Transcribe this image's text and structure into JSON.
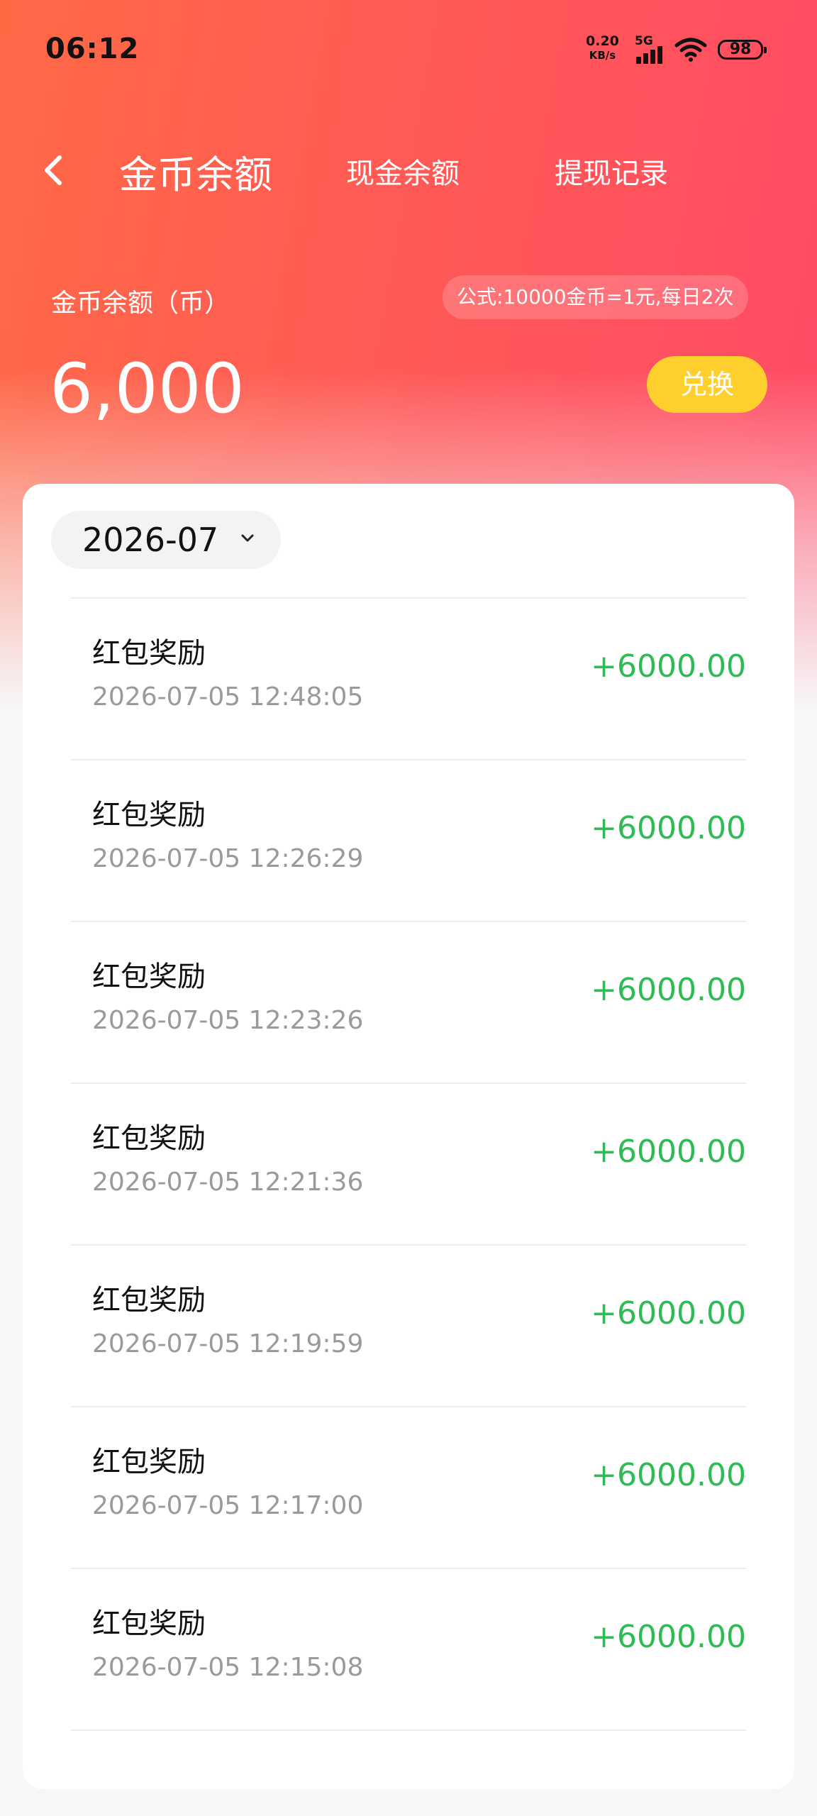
{
  "status_bar": {
    "time": "06:12",
    "net_speed": "0.20",
    "net_unit": "KB/s",
    "network": "5G",
    "battery": "98"
  },
  "nav": {
    "back_icon": "chevron-left-icon",
    "tabs": [
      {
        "label": "金币余额",
        "active": true
      },
      {
        "label": "现金余额",
        "active": false
      },
      {
        "label": "提现记录",
        "active": false
      }
    ]
  },
  "balance": {
    "label": "金币余额（币）",
    "formula": "公式:10000金币=1元,每日2次",
    "value": "6,000",
    "exchange_label": "兑换"
  },
  "filter": {
    "month": "2026-07"
  },
  "records": [
    {
      "title": "红包奖励",
      "time": "2026-07-05 12:48:05",
      "amount": "+6000.00"
    },
    {
      "title": "红包奖励",
      "time": "2026-07-05 12:26:29",
      "amount": "+6000.00"
    },
    {
      "title": "红包奖励",
      "time": "2026-07-05 12:23:26",
      "amount": "+6000.00"
    },
    {
      "title": "红包奖励",
      "time": "2026-07-05 12:21:36",
      "amount": "+6000.00"
    },
    {
      "title": "红包奖励",
      "time": "2026-07-05 12:19:59",
      "amount": "+6000.00"
    },
    {
      "title": "红包奖励",
      "time": "2026-07-05 12:17:00",
      "amount": "+6000.00"
    },
    {
      "title": "红包奖励",
      "time": "2026-07-05 12:15:08",
      "amount": "+6000.00"
    }
  ],
  "colors": {
    "header_start": "#ff6a45",
    "header_end": "#ff4a66",
    "exchange_button": "#ffd02d",
    "amount_positive": "#2dbb53"
  }
}
